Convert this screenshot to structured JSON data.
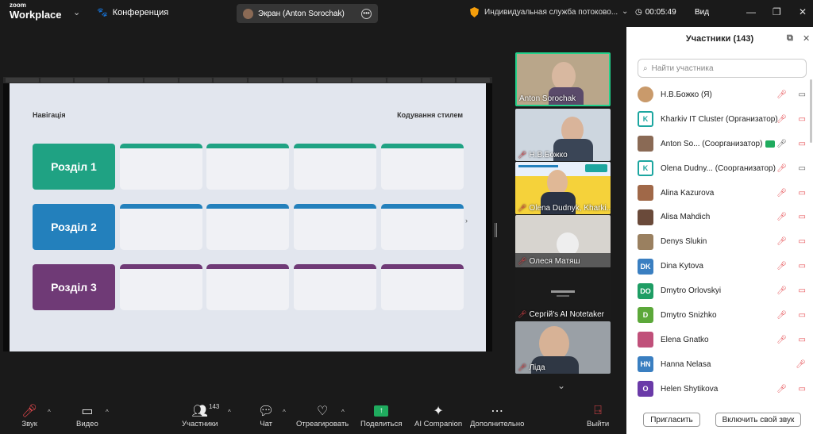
{
  "app": {
    "brand_small": "zoom",
    "brand_large": "Workplace",
    "meeting_label": "Конференция"
  },
  "screen_share": {
    "label": "Экран (Anton Sorochak)"
  },
  "service_text": "Индивидуальная служба потоково...",
  "timer": "00:05:49",
  "view_label": "Вид",
  "slide": {
    "nav_label": "Навігація",
    "style_label": "Кодування стилем",
    "sections": [
      {
        "label": "Розділ 1",
        "color": "#1fa283"
      },
      {
        "label": "Розділ 2",
        "color": "#2380bc"
      },
      {
        "label": "Розділ 3",
        "color": "#6f3a76"
      }
    ]
  },
  "video_tiles": [
    {
      "name": "Anton Sorochak",
      "muted": false
    },
    {
      "name": "Н.В.Божко",
      "muted": true
    },
    {
      "name": "Olena Dudnyk, Kharki...",
      "muted": true
    },
    {
      "name": "Олеся Матяш",
      "muted": true
    },
    {
      "name": "Сергій's AI Notetaker",
      "muted": true
    },
    {
      "name": "Ліда",
      "muted": true
    }
  ],
  "participants": {
    "title": "Участники (143)",
    "search_placeholder": "Найти участника",
    "items": [
      {
        "name": "Н.В.Божко (Я)",
        "avatar": "",
        "color": "#c99a6b",
        "mic": "off",
        "cam": "on"
      },
      {
        "name": "Kharkiv IT Cluster (Организатор)",
        "avatar": "K",
        "color": "#1ca6a0",
        "mic": "off",
        "cam": "off"
      },
      {
        "name": "Anton So... (Соорганизатор)",
        "avatar": "",
        "color": "#8a6a55",
        "mic": "on",
        "cam": "off"
      },
      {
        "name": "Olena Dudny... (Соорганизатор)",
        "avatar": "K",
        "color": "#1ca6a0",
        "mic": "off",
        "cam": "on"
      },
      {
        "name": "Alina Kazurova",
        "avatar": "",
        "color": "#a06848",
        "mic": "off",
        "cam": "off"
      },
      {
        "name": "Alisa Mahdich",
        "avatar": "",
        "color": "#6a4a3a",
        "mic": "off",
        "cam": "off"
      },
      {
        "name": "Denys Slukin",
        "avatar": "",
        "color": "#9a8060",
        "mic": "off",
        "cam": "off"
      },
      {
        "name": "Dina Kytova",
        "avatar": "DK",
        "color": "#3a7fc1",
        "mic": "off",
        "cam": "off"
      },
      {
        "name": "Dmytro Orlovskyi",
        "avatar": "DO",
        "color": "#1e9d64",
        "mic": "off",
        "cam": "off"
      },
      {
        "name": "Dmytro Snizhko",
        "avatar": "D",
        "color": "#5ca83a",
        "mic": "off",
        "cam": "off"
      },
      {
        "name": "Elena Gnatko",
        "avatar": "",
        "color": "#c0507a",
        "mic": "off",
        "cam": "off"
      },
      {
        "name": "Hanna Nelasa",
        "avatar": "HN",
        "color": "#3a7fc1",
        "mic": "off",
        "cam": "none"
      },
      {
        "name": "Helen Shytikova",
        "avatar": "O",
        "color": "#6a3aa8",
        "mic": "off",
        "cam": "off"
      }
    ],
    "invite_label": "Пригласить",
    "unmute_label": "Включить свой звук"
  },
  "toolbar": {
    "audio": "Звук",
    "video": "Видео",
    "participants": "Участники",
    "participants_count": "143",
    "chat": "Чат",
    "react": "Отреагировать",
    "share": "Поделиться",
    "ai": "AI Companion",
    "more": "Дополнительно",
    "leave": "Выйти"
  }
}
